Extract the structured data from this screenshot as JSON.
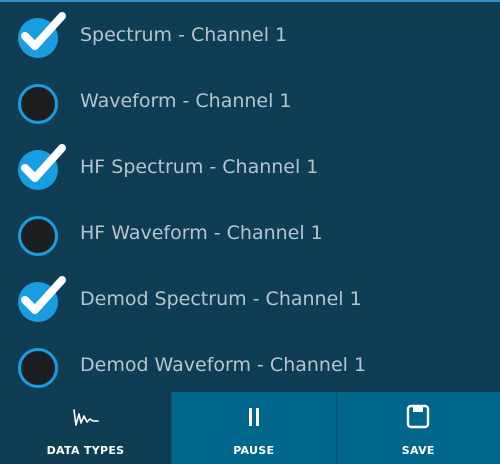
{
  "channel_list": {
    "items": [
      {
        "label": "Spectrum - Channel 1",
        "checked": true
      },
      {
        "label": "Waveform - Channel 1",
        "checked": false
      },
      {
        "label": "HF Spectrum - Channel 1",
        "checked": true
      },
      {
        "label": "HF Waveform - Channel 1",
        "checked": false
      },
      {
        "label": "Demod Spectrum - Channel 1",
        "checked": true
      },
      {
        "label": "Demod Waveform - Channel 1",
        "checked": false
      }
    ]
  },
  "toolbar": {
    "data_types_label": "DATA TYPES",
    "data_types_icon": "waveform-icon",
    "pause_label": "PAUSE",
    "pause_icon": "pause-icon",
    "save_label": "SAVE",
    "save_icon": "save-icon"
  },
  "colors": {
    "background": "#0e3d54",
    "accent": "#1a9ce0",
    "toolbar_active": "#00668c",
    "radio_fill": "#1c1e20",
    "label_text": "#b6c5cd"
  }
}
